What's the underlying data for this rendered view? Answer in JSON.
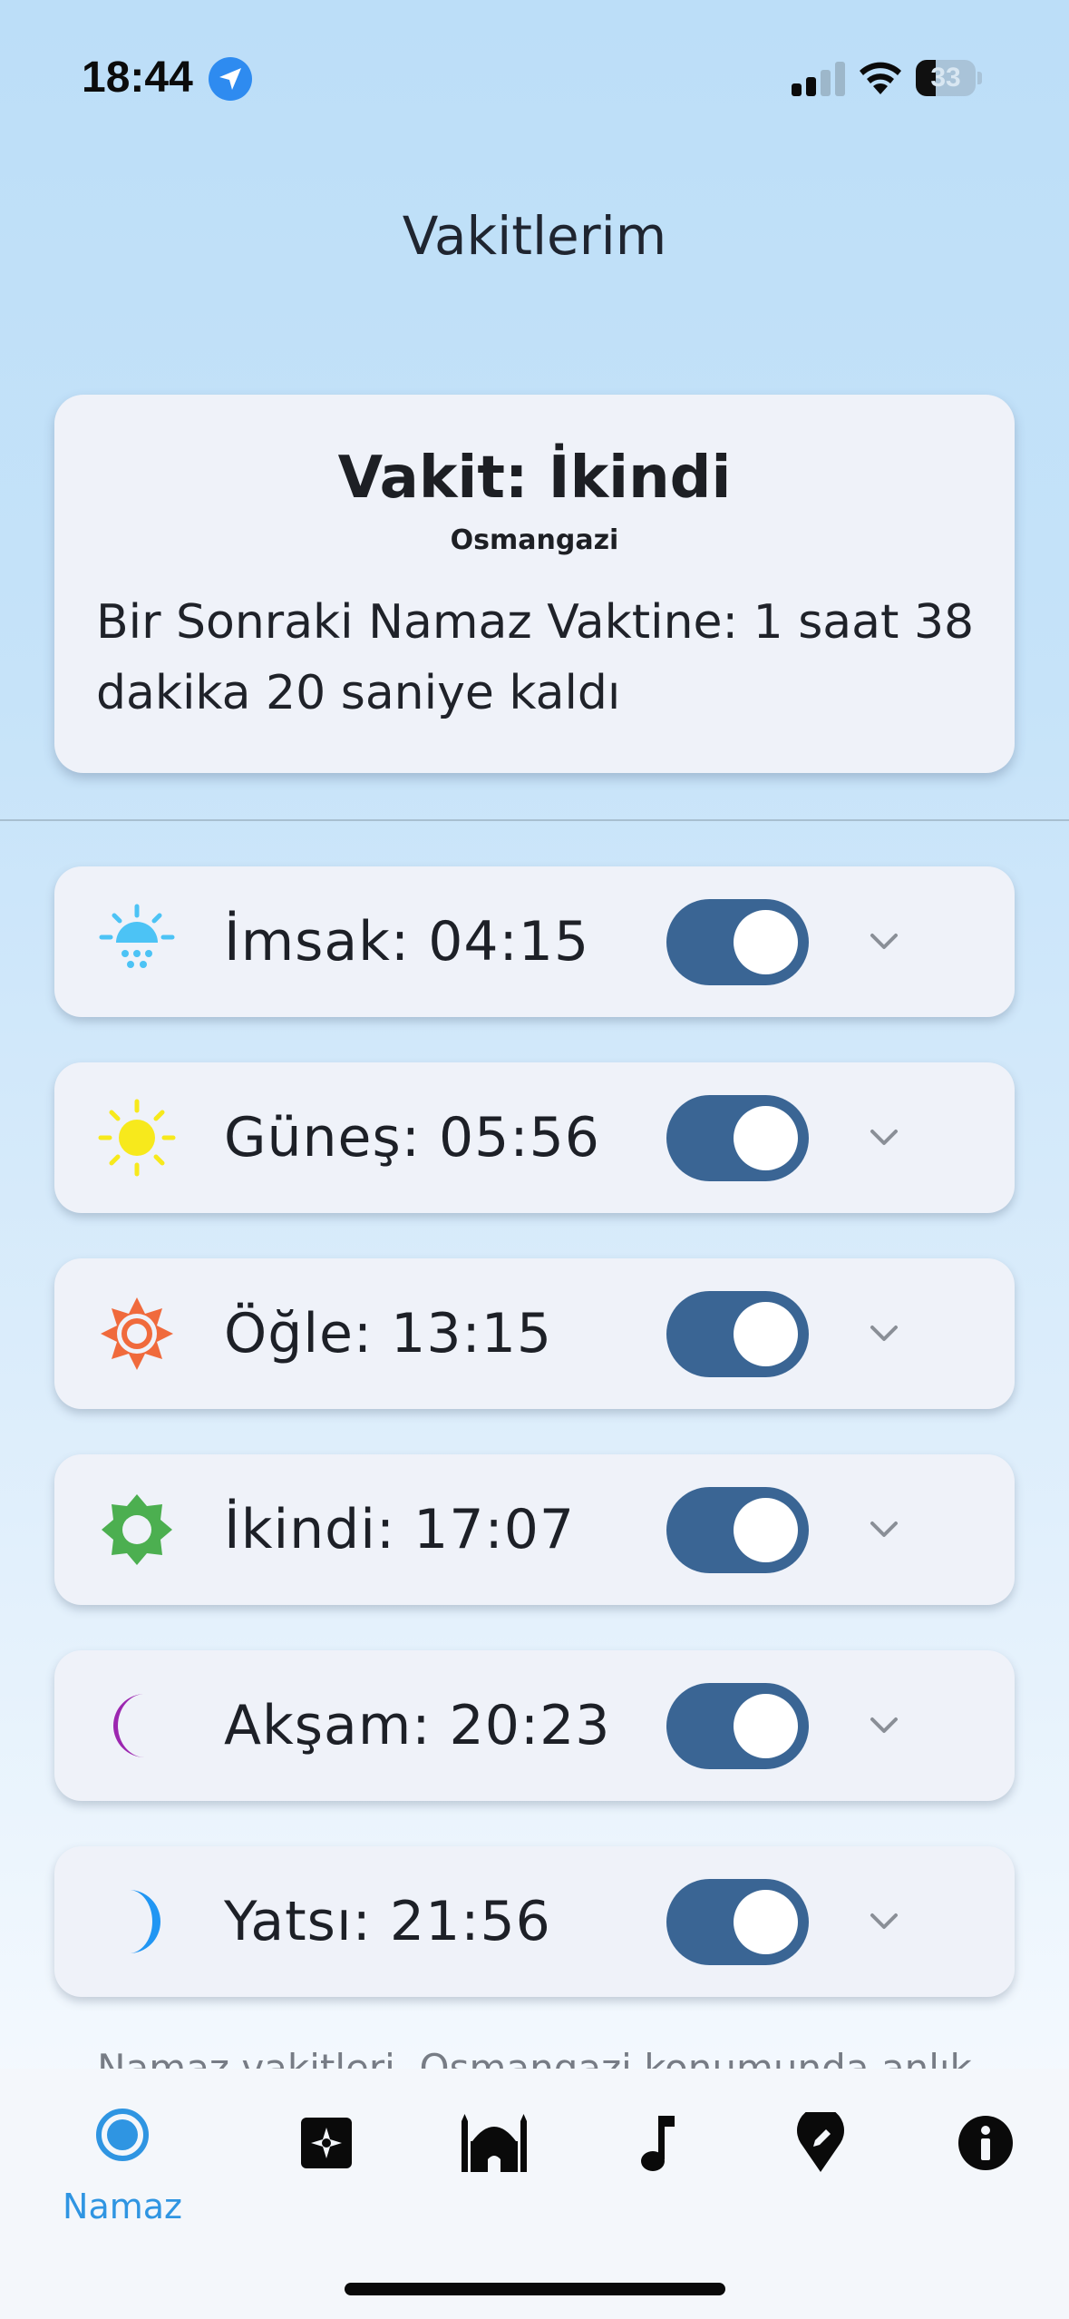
{
  "status_bar": {
    "time": "18:44",
    "battery_level": "33",
    "battery_fraction": 0.33,
    "signal_bars_active": 2,
    "signal_bars_total": 4
  },
  "page": {
    "title": "Vakitlerim"
  },
  "current": {
    "title": "Vakit: İkindi",
    "location": "Osmangazi",
    "countdown": "Bir Sonraki Namaz Vaktine: 1 saat 38 dakika 20 saniye kaldı"
  },
  "prayers": [
    {
      "label": "İmsak: 04:15",
      "icon": "sunrise-icon",
      "enabled": true
    },
    {
      "label": "Güneş: 05:56",
      "icon": "sun-icon",
      "enabled": true
    },
    {
      "label": "Öğle: 13:15",
      "icon": "noon-sun-icon",
      "enabled": true
    },
    {
      "label": "İkindi: 17:07",
      "icon": "afternoon-sun-icon",
      "enabled": true
    },
    {
      "label": "Akşam: 20:23",
      "icon": "crescent-moon-icon",
      "enabled": true
    },
    {
      "label": "Yatsı: 21:56",
      "icon": "night-moon-icon",
      "enabled": true
    }
  ],
  "footer": {
    "note": "Namaz vakitleri, Osmangazi konumunda anlık"
  },
  "tabbar": {
    "items": [
      {
        "label": "Namaz",
        "icon": "prayer-ring-icon",
        "active": true
      },
      {
        "label": "",
        "icon": "qibla-icon",
        "active": false
      },
      {
        "label": "",
        "icon": "mosque-icon",
        "active": false
      },
      {
        "label": "",
        "icon": "music-note-icon",
        "active": false
      },
      {
        "label": "",
        "icon": "location-pin-icon",
        "active": false
      },
      {
        "label": "",
        "icon": "info-icon",
        "active": false
      }
    ]
  },
  "colors": {
    "accent": "#2f95e2",
    "toggle_on": "#3a6594",
    "imsak": "#4cc3f5",
    "gunes": "#f7e91c",
    "ogle": "#f06a3c",
    "ikindi": "#4caf50",
    "aksam": "#9c27b0",
    "yatsi": "#2196f3"
  }
}
